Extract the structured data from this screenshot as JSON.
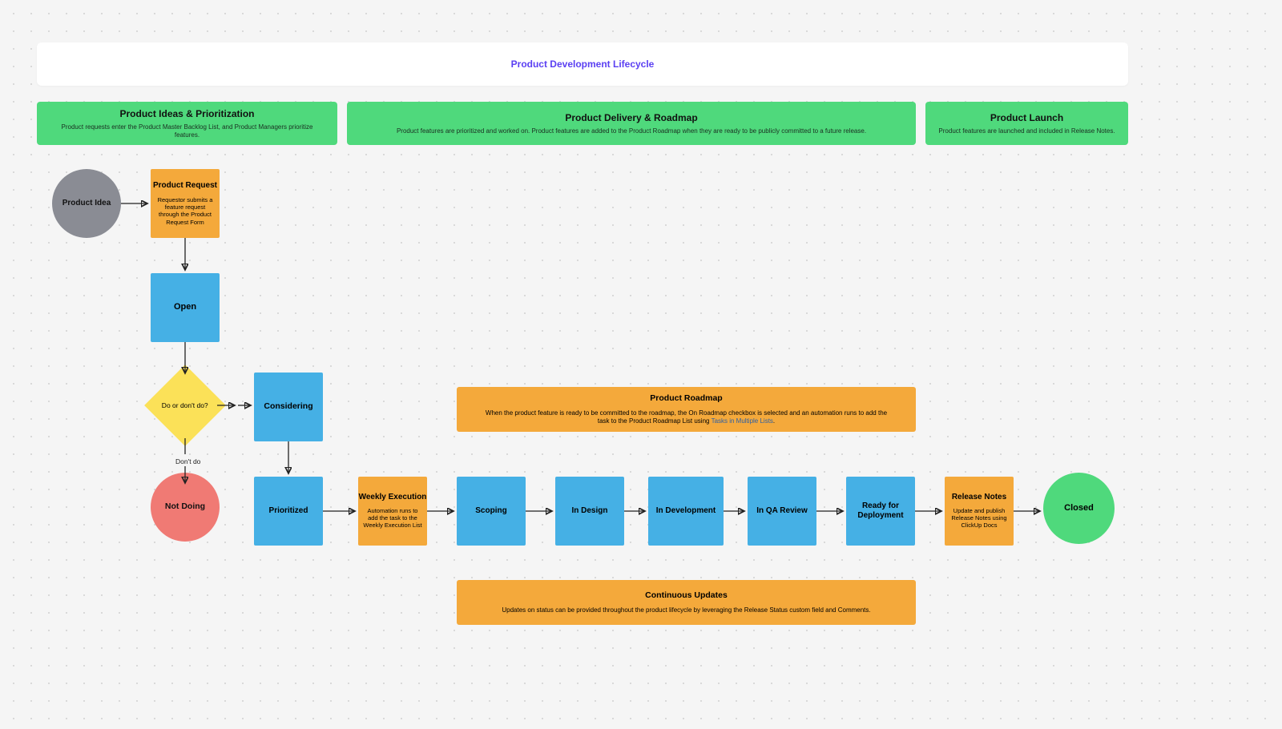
{
  "title": "Product Development Lifecycle",
  "sections": {
    "ideas": {
      "heading": "Product Ideas & Prioritization",
      "desc": "Product requests enter the Product Master Backlog List, and Product Managers prioritize features."
    },
    "delivery": {
      "heading": "Product Delivery & Roadmap",
      "desc": "Product features are prioritized and worked on. Product features are added to the Product Roadmap when they are ready to be publicly committed to a future release."
    },
    "launch": {
      "heading": "Product Launch",
      "desc": "Product features are launched and included in Release Notes."
    }
  },
  "nodes": {
    "product_idea": "Product Idea",
    "product_request": {
      "heading": "Product Request",
      "desc": "Requestor submits a feature request through the Product Request Form"
    },
    "open": "Open",
    "decision": "Do or don't do?",
    "decision_dont_label": "Don't do",
    "considering": "Considering",
    "not_doing": "Not Doing",
    "prioritized": "Prioritized",
    "weekly": {
      "heading": "Weekly Execution",
      "desc": "Automation runs to add the task to the Weekly Execution List"
    },
    "scoping": "Scoping",
    "in_design": "In Design",
    "in_development": "In Development",
    "in_qa": "In QA Review",
    "ready_deploy": "Ready for Deployment",
    "release_notes": {
      "heading": "Release Notes",
      "desc": "Update and publish Release Notes using ClickUp Docs"
    },
    "closed": "Closed"
  },
  "roadmap": {
    "heading": "Product Roadmap",
    "desc_pre": "When the product feature is ready to be committed to the roadmap, the On Roadmap checkbox is selected and an automation runs to add the task to the Product Roadmap List using ",
    "desc_link": "Tasks in Multiple Lists",
    "desc_post": "."
  },
  "continuous": {
    "heading": "Continuous Updates",
    "desc": "Updates on status can be provided throughout the product lifecycle by leveraging the Release Status custom field and Comments."
  }
}
